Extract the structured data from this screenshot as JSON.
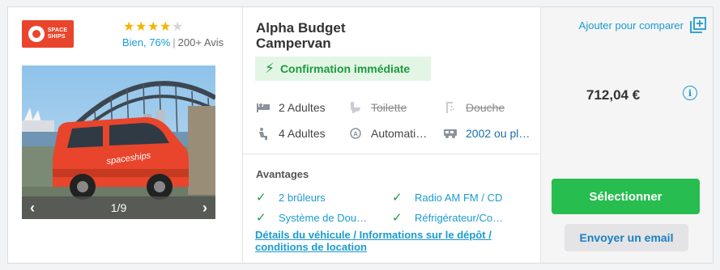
{
  "vendor": {
    "logo_name": "Spaceships"
  },
  "rating": {
    "stars_filled": 4,
    "stars_total": 5,
    "label": "Bien, 76%",
    "separator": "|",
    "count": "200+ Avis"
  },
  "gallery": {
    "counter": "1/9",
    "prev_icon": "chevron-left-icon",
    "next_icon": "chevron-right-icon"
  },
  "vehicle": {
    "title_line1": "Alpha Budget",
    "title_line2": "Campervan",
    "confirmation": "Confirmation immédiate",
    "specs": [
      {
        "icon": "bed-icon",
        "label": "2 Adultes",
        "available": true
      },
      {
        "icon": "toilet-icon",
        "label": "Toilette",
        "available": false
      },
      {
        "icon": "shower-icon",
        "label": "Douche",
        "available": false
      },
      {
        "icon": "seat-icon",
        "label": "4 Adultes",
        "available": true
      },
      {
        "icon": "transmission-icon",
        "label": "Automati…",
        "available": true
      },
      {
        "icon": "vehicle-year-icon",
        "label": "2002 ou pl…",
        "available": true
      }
    ]
  },
  "advantages": {
    "title": "Avantages",
    "items": [
      "2 brûleurs",
      "Radio AM FM / CD",
      "Système de Dou…",
      "Réfrigérateur/Co…"
    ]
  },
  "details_link": {
    "line1": "Détails du véhicule / Informations sur le dépôt /",
    "line2": "conditions de location"
  },
  "actions": {
    "compare_label": "Ajouter pour comparer",
    "price": "712,04 €",
    "select_label": "Sélectionner",
    "email_label": "Envoyer un email"
  },
  "colors": {
    "accent_blue": "#1a9bd0",
    "green": "#27bd4f",
    "brand_red": "#e8452c",
    "star": "#f4b400"
  }
}
